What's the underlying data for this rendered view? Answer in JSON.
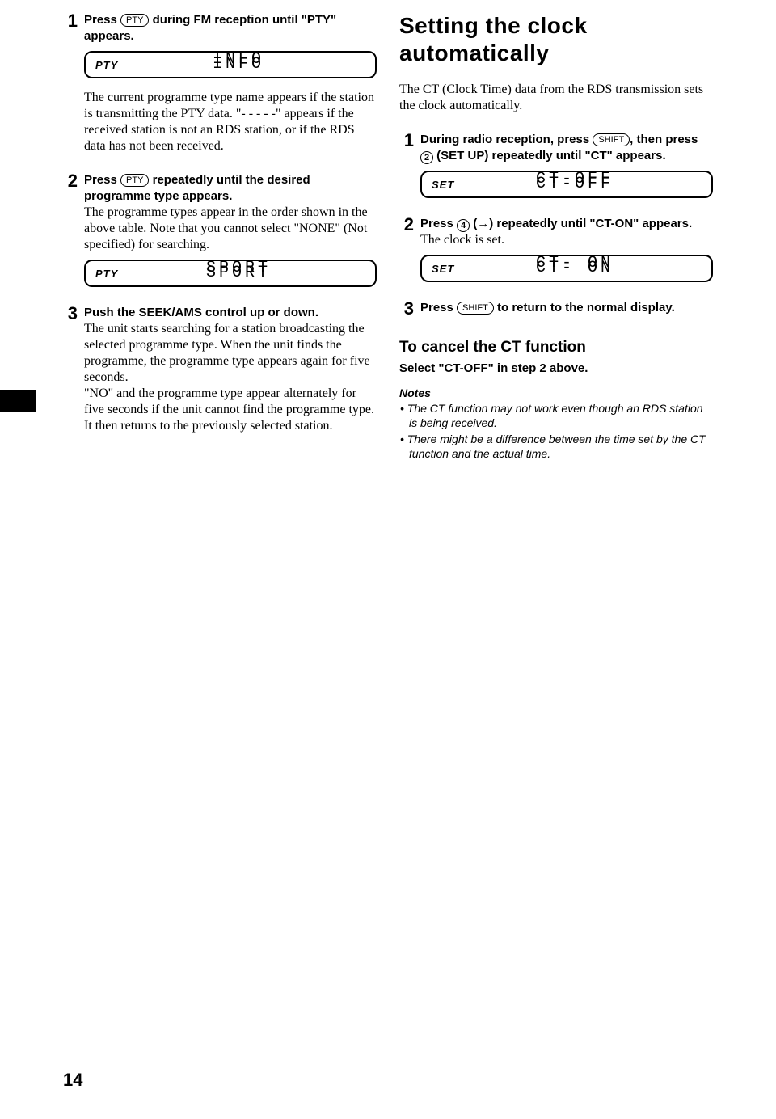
{
  "left": {
    "steps": [
      {
        "num": "1",
        "bold_before": "Press ",
        "key": "PTY",
        "bold_after": " during FM reception until \"PTY\" appears.",
        "display": {
          "indicator": "PTY",
          "text": "INFO"
        },
        "body": "The current programme type name appears if the station is transmitting the PTY data. \"- - - - -\" appears if the received station is not an RDS station, or if the RDS data has not been received."
      },
      {
        "num": "2",
        "bold_before": "Press ",
        "key": "PTY",
        "bold_after": " repeatedly until the desired programme type appears.",
        "body": "The programme types appear in the order shown in the above table. Note that you cannot select \"NONE\" (Not specified) for searching.",
        "display": {
          "indicator": "PTY",
          "text": "SPORT"
        }
      },
      {
        "num": "3",
        "bold_before": "Push the SEEK/AMS control up or down.",
        "body": "The unit starts searching for a station broadcasting the selected programme type. When the unit finds the programme, the programme type appears again for five seconds.\n\"NO\" and the programme type appear alternately for five seconds if the unit cannot find the programme type. It then returns to the previously selected station."
      }
    ]
  },
  "right": {
    "title": "Setting the clock automatically",
    "intro": "The CT (Clock Time) data from the RDS transmission sets the clock automatically.",
    "steps": [
      {
        "num": "1",
        "bold_a": "During radio reception, press ",
        "key1": "SHIFT",
        "bold_b": ", then press ",
        "key2": "2",
        "bold_c": " (SET UP) repeatedly until \"CT\" appears.",
        "display": {
          "indicator": "SET",
          "text": "CT-OFF"
        }
      },
      {
        "num": "2",
        "bold_a": "Press ",
        "key1": "4",
        "bold_b": " (→) repeatedly until \"CT-ON\" appears.",
        "body": "The clock is set.",
        "display": {
          "indicator": "SET",
          "text": "CT- ON"
        }
      },
      {
        "num": "3",
        "bold_a": "Press ",
        "key1": "SHIFT",
        "bold_b": " to return to the normal display."
      }
    ],
    "cancel_heading": "To cancel the CT function",
    "cancel_body": "Select \"CT-OFF\" in step 2 above.",
    "notes_heading": "Notes",
    "notes": [
      "The CT function may not work even though an RDS station is being received.",
      "There might be a difference between the time set by the CT function and the actual time."
    ]
  },
  "page_number": "14"
}
